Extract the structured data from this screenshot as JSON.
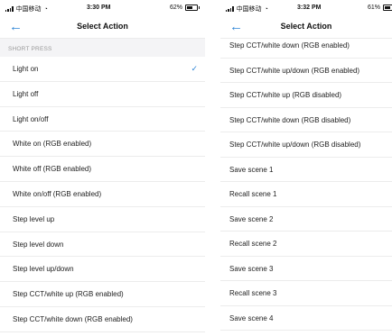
{
  "left": {
    "status": {
      "carrier": "中国移动",
      "time": "3:30 PM",
      "battery": "62%",
      "battery_level": 0.62
    },
    "title": "Select Action",
    "section": "SHORT PRESS",
    "items": [
      {
        "label": "Light on",
        "selected": true
      },
      {
        "label": "Light off",
        "selected": false
      },
      {
        "label": "Light on/off",
        "selected": false
      },
      {
        "label": "White on (RGB enabled)",
        "selected": false
      },
      {
        "label": "White off (RGB enabled)",
        "selected": false
      },
      {
        "label": "White on/off (RGB enabled)",
        "selected": false
      },
      {
        "label": "Step level up",
        "selected": false
      },
      {
        "label": "Step level down",
        "selected": false
      },
      {
        "label": "Step level up/down",
        "selected": false
      },
      {
        "label": "Step CCT/white up (RGB enabled)",
        "selected": false
      },
      {
        "label": "Step CCT/white down (RGB enabled)",
        "selected": false
      }
    ]
  },
  "right": {
    "status": {
      "carrier": "中国移动",
      "time": "3:32 PM",
      "battery": "61%",
      "battery_level": 0.61
    },
    "title": "Select Action",
    "items": [
      {
        "label": "Step CCT/white down (RGB enabled)"
      },
      {
        "label": "Step CCT/white up/down (RGB enabled)"
      },
      {
        "label": "Step CCT/white up (RGB disabled)"
      },
      {
        "label": "Step CCT/white down (RGB disabled)"
      },
      {
        "label": "Step CCT/white up/down (RGB disabled)"
      },
      {
        "label": "Save scene 1"
      },
      {
        "label": "Recall scene 1"
      },
      {
        "label": "Save scene 2"
      },
      {
        "label": "Recall scene 2"
      },
      {
        "label": "Save scene 3"
      },
      {
        "label": "Recall scene 3"
      },
      {
        "label": "Save scene 4"
      }
    ]
  },
  "icons": {
    "back": "back-arrow-icon",
    "check": "checkmark-icon",
    "wifi": "wifi-icon",
    "signal": "signal-icon",
    "battery": "battery-icon"
  },
  "colors": {
    "accent": "#2f86d6",
    "section_bg": "#f4f4f6",
    "divider": "#ececec"
  }
}
